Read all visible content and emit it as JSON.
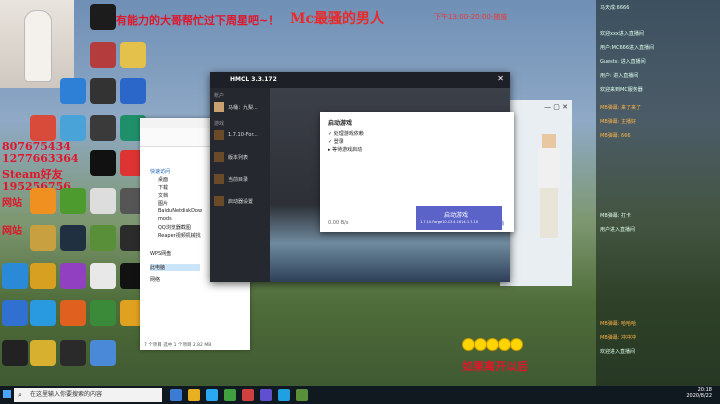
{
  "stream": {
    "title": "Mc最骚的男人",
    "top_banner": "有能力的大哥帮忙过下周星吧~！",
    "schedule": "下午13:00-20:00-随废",
    "contact_1": "807675434",
    "contact_2": "1277663364",
    "contact_3": "Steam好友",
    "contact_4": "195256756",
    "side_1": "网站",
    "side_2": "网站",
    "bottom_banner": "如果离开以后"
  },
  "hmcl": {
    "title": "HMCL 3.3.172",
    "account_label": "账户",
    "account_name": "马桶：九梨...",
    "version_label": "游戏",
    "version_item": "1.7.10-For...",
    "menu_1": "版本列表",
    "menu_2": "当前目录",
    "menu_3": "启动器设置",
    "dialog_title": "启动游戏",
    "steps": [
      "处理游戏依赖",
      "登录",
      "等待游戏启动"
    ],
    "speed": "0.00 B/s",
    "cancel": "取消",
    "launch_label": "启动游戏",
    "launch_sub": "1.7.10-Forge10.13.4.1614-1.7.10"
  },
  "explorer": {
    "quick_access": "快速访问",
    "items": [
      "桌面",
      "下载",
      "文档",
      "图片",
      "BaiduNetdiskDow",
      "mods",
      "QQ浏览器截图",
      "Reaper视频机械找"
    ],
    "wps": "WPS网盘",
    "this_pc": "此电脑",
    "network": "网络",
    "status": "7 个项目    选中 1 个项目  2.82 MB"
  },
  "taskbar": {
    "search_placeholder": "在这里输入你要搜索的内容",
    "time": "20:18",
    "date": "2020/8/22"
  },
  "chat": [
    "马天成:6666",
    "欢迎xxx进入直播间",
    "用户:MC666进入直播间",
    "Guests: 进入直播间",
    "用户: 进入直播间",
    "欢迎来到MC服务器",
    "MB弹幕: 来了来了",
    "MB弹幕: 主播好",
    "MB弹幕: 666",
    "MB弹幕: 打卡",
    "用户进入直播间",
    "MB弹幕: 哈哈哈",
    "MB弹幕: 冲冲冲",
    "欢迎进入直播间"
  ],
  "icons": [
    "search-icon",
    "windows-icon",
    "folder-icon",
    "minecraft-icon",
    "qq-icon"
  ]
}
